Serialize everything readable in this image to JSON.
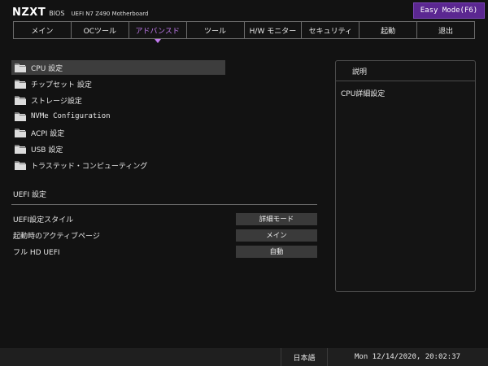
{
  "header": {
    "brand": "NZXT",
    "bios": "BIOS",
    "model": "UEFI N7 Z490 Motherboard",
    "easy_mode": "Easy Mode(F6)"
  },
  "tabs": [
    {
      "label": "メイン"
    },
    {
      "label": "OCツール"
    },
    {
      "label": "アドバンスド",
      "active": true
    },
    {
      "label": "ツール"
    },
    {
      "label": "H/W モニター"
    },
    {
      "label": "セキュリティ"
    },
    {
      "label": "起動"
    },
    {
      "label": "退出"
    }
  ],
  "menu": [
    {
      "label": "CPU 設定",
      "selected": true
    },
    {
      "label": "チップセット 設定"
    },
    {
      "label": "ストレージ設定"
    },
    {
      "label": "NVMe Configuration"
    },
    {
      "label": "ACPI 設定"
    },
    {
      "label": "USB 設定"
    },
    {
      "label": "トラステッド・コンピューティング"
    }
  ],
  "uefi": {
    "title": "UEFI 設定",
    "settings": [
      {
        "label": "UEFI設定スタイル",
        "value": "詳細モード"
      },
      {
        "label": "起動時のアクティブページ",
        "value": "メイン"
      },
      {
        "label": "フル HD UEFI",
        "value": "自動"
      }
    ]
  },
  "help": {
    "title": "説明",
    "text": "CPU詳細設定"
  },
  "footer": {
    "language": "日本語",
    "datetime": "Mon 12/14/2020, 20:02:37"
  },
  "colors": {
    "background": "#121212",
    "accent": "#c27bf0",
    "easy_mode_bg": "#5b2791"
  }
}
